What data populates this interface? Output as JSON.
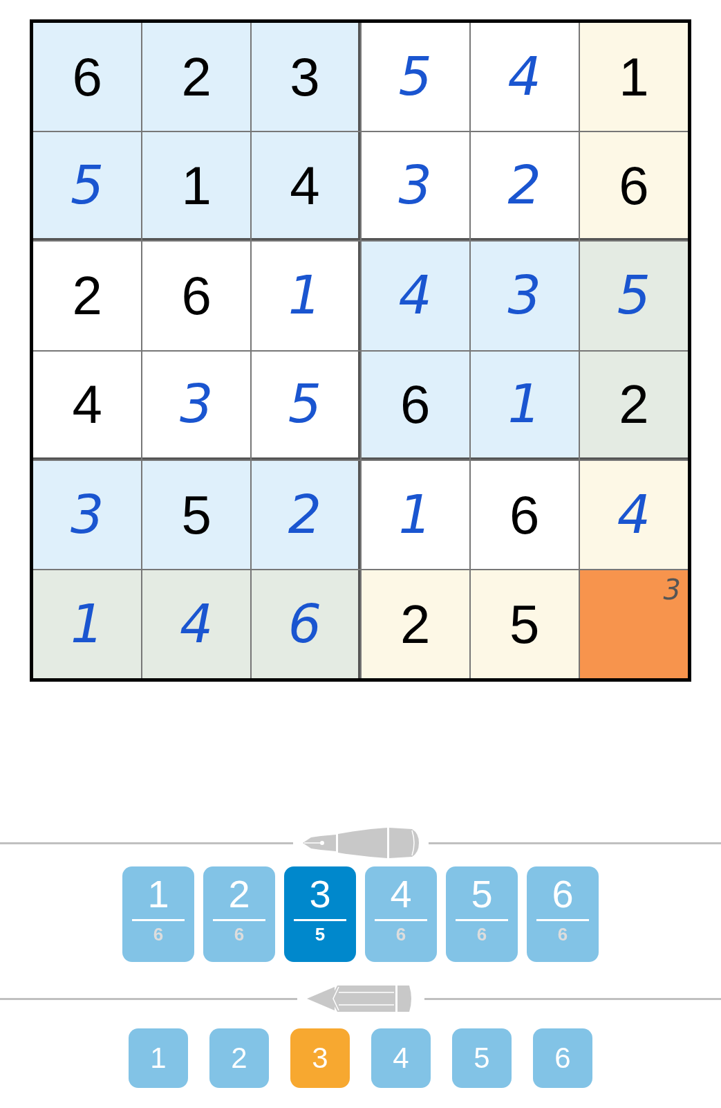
{
  "grid": {
    "rows": [
      [
        {
          "value": "6",
          "kind": "given",
          "shaded": true,
          "highlighted": false,
          "selected": false
        },
        {
          "value": "2",
          "kind": "given",
          "shaded": true,
          "highlighted": false,
          "selected": false
        },
        {
          "value": "3",
          "kind": "given",
          "shaded": true,
          "highlighted": false,
          "selected": false
        },
        {
          "value": "5",
          "kind": "entered",
          "shaded": false,
          "highlighted": false,
          "selected": false
        },
        {
          "value": "4",
          "kind": "entered",
          "shaded": false,
          "highlighted": false,
          "selected": false
        },
        {
          "value": "1",
          "kind": "given",
          "shaded": false,
          "highlighted": true,
          "selected": false
        }
      ],
      [
        {
          "value": "5",
          "kind": "entered",
          "shaded": true,
          "highlighted": false,
          "selected": false
        },
        {
          "value": "1",
          "kind": "given",
          "shaded": true,
          "highlighted": false,
          "selected": false
        },
        {
          "value": "4",
          "kind": "given",
          "shaded": true,
          "highlighted": false,
          "selected": false
        },
        {
          "value": "3",
          "kind": "entered",
          "shaded": false,
          "highlighted": false,
          "selected": false
        },
        {
          "value": "2",
          "kind": "entered",
          "shaded": false,
          "highlighted": false,
          "selected": false
        },
        {
          "value": "6",
          "kind": "given",
          "shaded": false,
          "highlighted": true,
          "selected": false
        }
      ],
      [
        {
          "value": "2",
          "kind": "given",
          "shaded": false,
          "highlighted": false,
          "selected": false
        },
        {
          "value": "6",
          "kind": "given",
          "shaded": false,
          "highlighted": false,
          "selected": false
        },
        {
          "value": "1",
          "kind": "entered",
          "shaded": false,
          "highlighted": false,
          "selected": false
        },
        {
          "value": "4",
          "kind": "entered",
          "shaded": true,
          "highlighted": false,
          "selected": false
        },
        {
          "value": "3",
          "kind": "entered",
          "shaded": true,
          "highlighted": false,
          "selected": false
        },
        {
          "value": "5",
          "kind": "entered",
          "shaded": true,
          "highlighted": true,
          "selected": false
        }
      ],
      [
        {
          "value": "4",
          "kind": "given",
          "shaded": false,
          "highlighted": false,
          "selected": false
        },
        {
          "value": "3",
          "kind": "entered",
          "shaded": false,
          "highlighted": false,
          "selected": false
        },
        {
          "value": "5",
          "kind": "entered",
          "shaded": false,
          "highlighted": false,
          "selected": false
        },
        {
          "value": "6",
          "kind": "given",
          "shaded": true,
          "highlighted": false,
          "selected": false
        },
        {
          "value": "1",
          "kind": "entered",
          "shaded": true,
          "highlighted": false,
          "selected": false
        },
        {
          "value": "2",
          "kind": "given",
          "shaded": true,
          "highlighted": true,
          "selected": false
        }
      ],
      [
        {
          "value": "3",
          "kind": "entered",
          "shaded": true,
          "highlighted": false,
          "selected": false
        },
        {
          "value": "5",
          "kind": "given",
          "shaded": true,
          "highlighted": false,
          "selected": false
        },
        {
          "value": "2",
          "kind": "entered",
          "shaded": true,
          "highlighted": false,
          "selected": false
        },
        {
          "value": "1",
          "kind": "entered",
          "shaded": false,
          "highlighted": false,
          "selected": false
        },
        {
          "value": "6",
          "kind": "given",
          "shaded": false,
          "highlighted": false,
          "selected": false
        },
        {
          "value": "4",
          "kind": "entered",
          "shaded": false,
          "highlighted": true,
          "selected": false
        }
      ],
      [
        {
          "value": "1",
          "kind": "entered",
          "shaded": true,
          "highlighted": true,
          "selected": false
        },
        {
          "value": "4",
          "kind": "entered",
          "shaded": true,
          "highlighted": true,
          "selected": false
        },
        {
          "value": "6",
          "kind": "entered",
          "shaded": true,
          "highlighted": true,
          "selected": false
        },
        {
          "value": "2",
          "kind": "given",
          "shaded": false,
          "highlighted": true,
          "selected": false
        },
        {
          "value": "5",
          "kind": "given",
          "shaded": false,
          "highlighted": true,
          "selected": false
        },
        {
          "note": "3",
          "kind": "empty",
          "selected": true
        }
      ]
    ]
  },
  "pen_keys": [
    {
      "digit": "1",
      "count": "6",
      "selected": false
    },
    {
      "digit": "2",
      "count": "6",
      "selected": false
    },
    {
      "digit": "3",
      "count": "5",
      "selected": true
    },
    {
      "digit": "4",
      "count": "6",
      "selected": false
    },
    {
      "digit": "5",
      "count": "6",
      "selected": false
    },
    {
      "digit": "6",
      "count": "6",
      "selected": false
    }
  ],
  "pencil_keys": [
    {
      "digit": "1",
      "selected": false
    },
    {
      "digit": "2",
      "selected": false
    },
    {
      "digit": "3",
      "selected": true
    },
    {
      "digit": "4",
      "selected": false
    },
    {
      "digit": "5",
      "selected": false
    },
    {
      "digit": "6",
      "selected": false
    }
  ]
}
